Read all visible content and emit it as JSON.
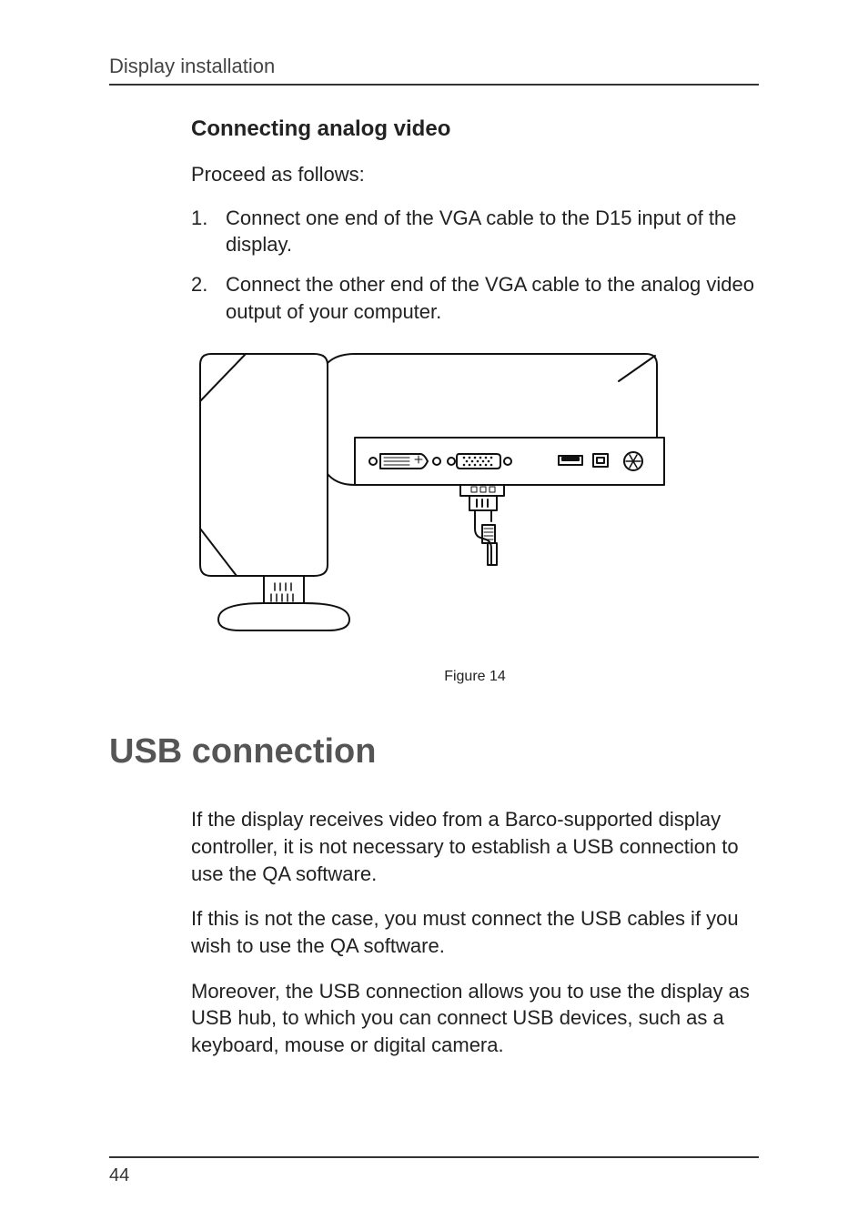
{
  "header": {
    "running": "Display installation"
  },
  "sectionA": {
    "subhead": "Connecting analog video",
    "lead": "Proceed as follows:",
    "steps": [
      {
        "num": "1.",
        "text": "Connect one end of the VGA cable to the D15 input of the display."
      },
      {
        "num": "2.",
        "text": "Connect the other end of the VGA cable to the analog video output of your computer."
      }
    ]
  },
  "figure": {
    "caption": "Figure 14"
  },
  "sectionB": {
    "title": "USB connection",
    "p1": "If the display receives video from a Barco-supported display controller, it is not necessary to establish a USB connection to use the QA software.",
    "p2": "If this is not the case, you must connect the USB cables if you wish to use the QA software.",
    "p3": "Moreover, the USB connection allows you to use the display as USB hub, to which you can connect USB devices, such as a keyboard, mouse or digital camera."
  },
  "footer": {
    "page": "44"
  }
}
